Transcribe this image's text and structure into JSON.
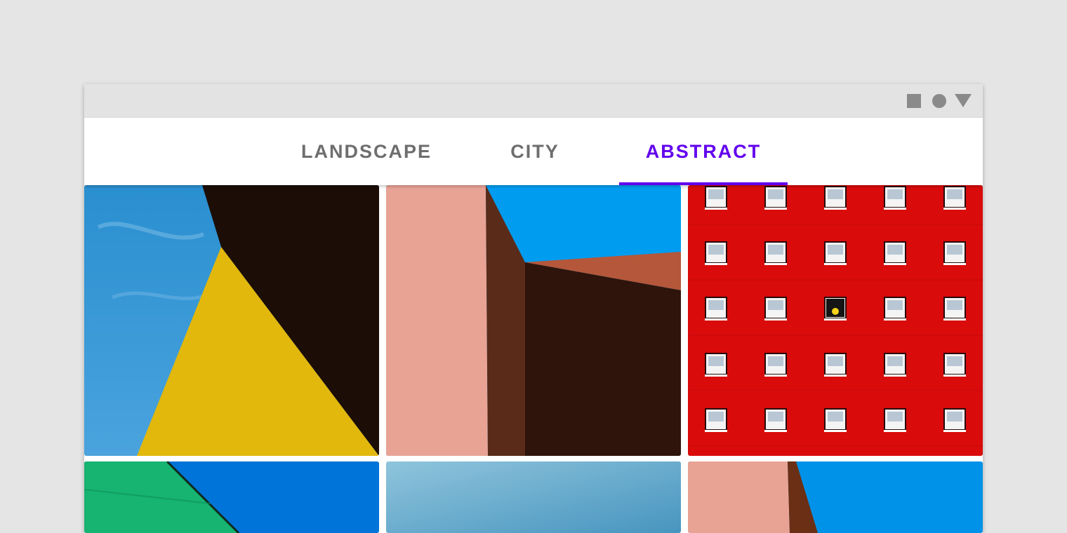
{
  "window": {
    "controls": [
      "square-icon",
      "circle-icon",
      "triangle-icon"
    ]
  },
  "tabs": {
    "items": [
      {
        "label": "LANDSCAPE",
        "active": false
      },
      {
        "label": "CITY",
        "active": false
      },
      {
        "label": "ABSTRACT",
        "active": true
      }
    ]
  },
  "colors": {
    "accent": "#6200ee",
    "tab_inactive": "#6e6e6e",
    "titlebar": "#e3e3e3",
    "background": "#e5e5e5"
  },
  "gallery": {
    "category": "ABSTRACT",
    "photos": [
      {
        "name": "yellow-wall-blue-sky-photo"
      },
      {
        "name": "pink-wall-blue-sky-photo"
      },
      {
        "name": "red-facade-windows-photo"
      },
      {
        "name": "green-panel-blue-sky-photo"
      },
      {
        "name": "light-blue-gradient-photo"
      },
      {
        "name": "pink-wall-corner-photo"
      }
    ]
  }
}
